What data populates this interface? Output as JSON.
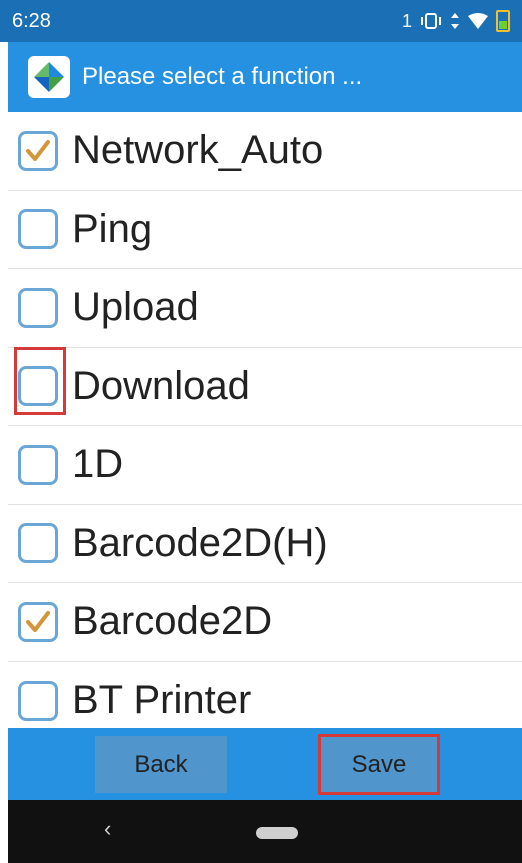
{
  "status_bar": {
    "time": "6:28",
    "notification_count": "1"
  },
  "title_bar": {
    "title": "Please select a function ..."
  },
  "list": {
    "items": [
      {
        "label": "Network_Auto",
        "checked": true
      },
      {
        "label": "Ping",
        "checked": false
      },
      {
        "label": "Upload",
        "checked": false
      },
      {
        "label": "Download",
        "checked": false
      },
      {
        "label": "1D",
        "checked": false
      },
      {
        "label": "Barcode2D(H)",
        "checked": false
      },
      {
        "label": "Barcode2D",
        "checked": true
      },
      {
        "label": "BT Printer",
        "checked": false
      }
    ]
  },
  "bottom_bar": {
    "back_label": "Back",
    "save_label": "Save"
  },
  "colors": {
    "status_bar": "#1b6fb4",
    "title_bar": "#2691e0",
    "checkmark": "#d4963a",
    "checkbox_border": "#6aa7d6",
    "highlight": "#d53a3a"
  }
}
